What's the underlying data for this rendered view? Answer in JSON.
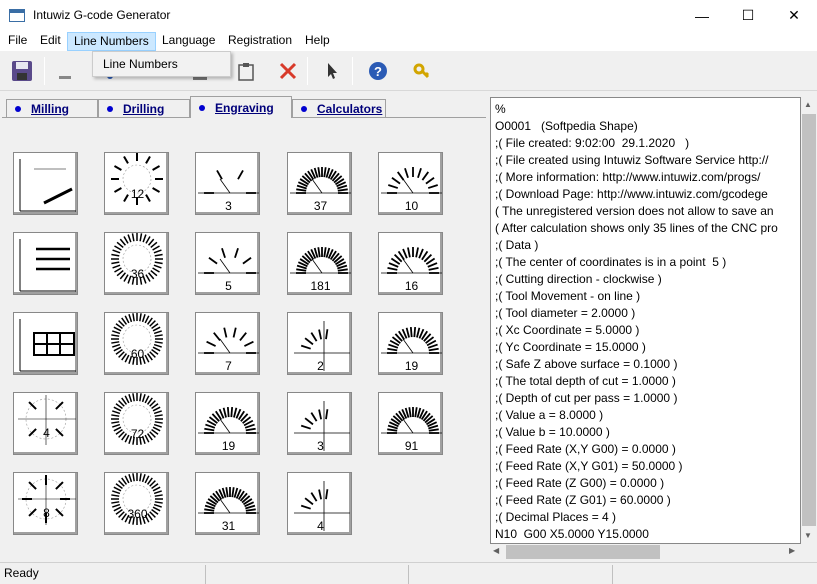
{
  "window": {
    "title": "Intuwiz G-code Generator",
    "minimize": "—",
    "maximize": "☐",
    "close": "✕"
  },
  "menu": {
    "items": [
      "File",
      "Edit",
      "Line Numbers",
      "Language",
      "Registration",
      "Help"
    ],
    "dropdown_item": "Line Numbers"
  },
  "toolbar": {
    "icons": [
      "save-icon",
      "edit-icon",
      "settings-icon",
      "copy-icon",
      "paste-icon",
      "delete-icon",
      "pointer-icon",
      "help-icon",
      "key-icon"
    ]
  },
  "tabs": [
    "Milling",
    "Drilling",
    "Engraving",
    "Calculators"
  ],
  "tiles": {
    "row1": [
      "",
      "12",
      "3",
      "37",
      "10"
    ],
    "row2": [
      "",
      "36",
      "5",
      "181",
      "16"
    ],
    "row3": [
      "",
      "60",
      "7",
      "2",
      "19"
    ],
    "row4": [
      "4",
      "72",
      "19",
      "3",
      "91"
    ],
    "row5": [
      "8",
      "360",
      "31",
      "4"
    ]
  },
  "code": {
    "lines": [
      "%",
      "O0001   (Softpedia Shape)",
      ";( File created: 9:02:00  29.1.2020   )",
      ";( File created using Intuwiz Software Service http://",
      ";( More information: http://www.intuwiz.com/progs/",
      ";( Download Page: http://www.intuwiz.com/gcodege",
      "( The unregistered version does not allow to save an",
      "( After calculation shows only 35 lines of the CNC pro",
      ";( Data )",
      ";( The center of coordinates is in a point  5 )",
      ";( Cutting direction - clockwise )",
      ";( Tool Movement - on line )",
      ";( Tool diameter = 2.0000 )",
      ";( Xc Coordinate = 5.0000 )",
      ";( Yc Coordinate = 15.0000 )",
      ";( Safe Z above surface = 0.1000 )",
      ";( The total depth of cut = 1.0000 )",
      ";( Depth of cut per pass = 1.0000 )",
      ";( Value a = 8.0000 )",
      ";( Value b = 10.0000 )",
      ";( Feed Rate (X,Y G00) = 0.0000 )",
      ";( Feed Rate (X,Y G01) = 50.0000 )",
      ";( Feed Rate (Z G00) = 0.0000 )",
      ";( Feed Rate (Z G01) = 60.0000 )",
      ";( Decimal Places = 4 )",
      "N10  G00 X5.0000 Y15.0000"
    ]
  },
  "status": {
    "text": "Ready"
  }
}
